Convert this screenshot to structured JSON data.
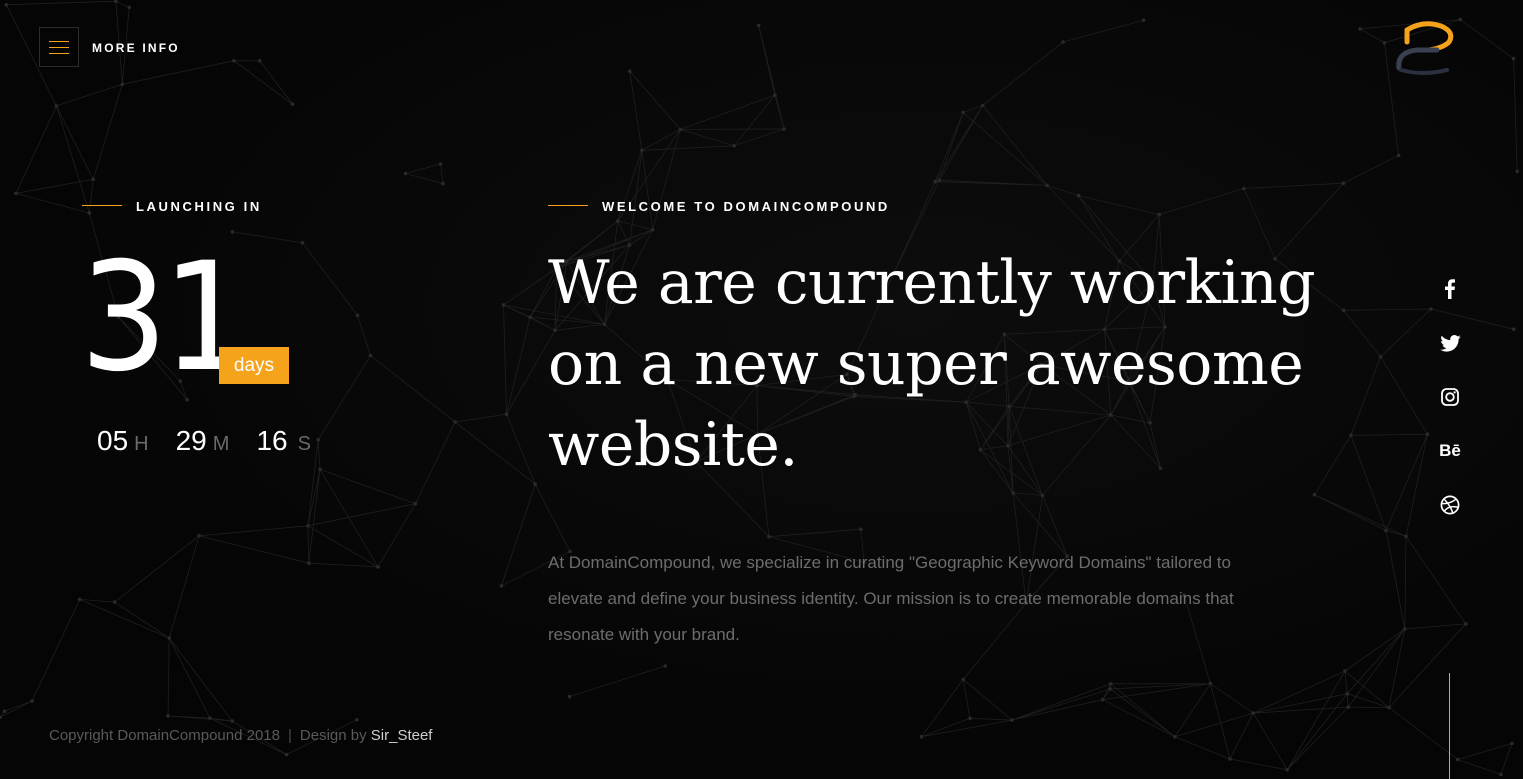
{
  "header": {
    "menu_label": "MORE INFO",
    "menu_icon": "hamburger-icon",
    "logo": "domaincompound-logo"
  },
  "countdown": {
    "eyebrow": "LAUNCHING IN",
    "days": "31",
    "days_label": "days",
    "hours": "05",
    "hours_letter": "H",
    "minutes": "29",
    "minutes_letter": "M",
    "seconds": "16",
    "seconds_letter": "S"
  },
  "main": {
    "eyebrow": "WELCOME TO DOMAINCOMPOUND",
    "headline": "We are currently working on a new super awesome website.",
    "description": "At DomainCompound, we specialize in curating \"Geographic Keyword Domains\" tailored to elevate and define your business identity. Our mission is to create memorable domains that resonate with your brand."
  },
  "social": [
    {
      "icon": "facebook-icon"
    },
    {
      "icon": "twitter-icon"
    },
    {
      "icon": "instagram-icon"
    },
    {
      "icon": "behance-icon",
      "text": "Bē"
    },
    {
      "icon": "dribbble-icon"
    }
  ],
  "footer": {
    "copyright": "Copyright DomainCompound 2018",
    "separator": "|",
    "design_prefix": "Design by",
    "designer": "Sir_Steef"
  },
  "colors": {
    "accent": "#f5a31a",
    "background": "#060606",
    "muted_text": "#6d6d6d"
  }
}
